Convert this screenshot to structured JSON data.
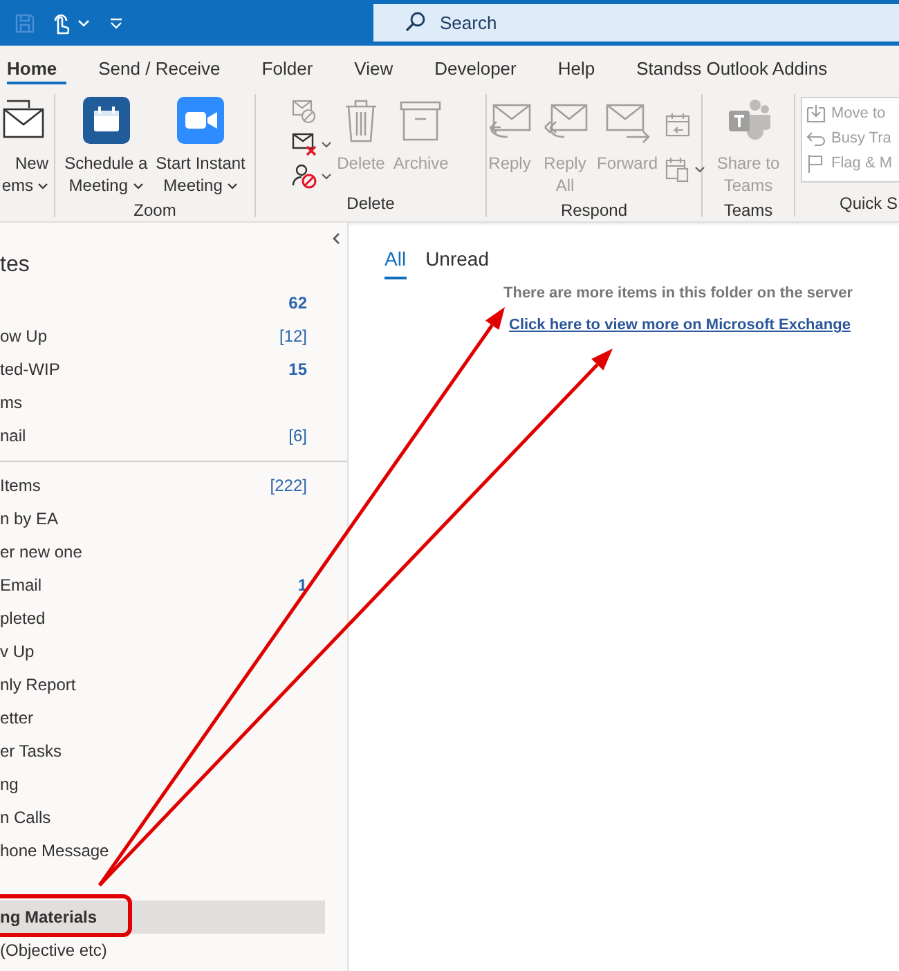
{
  "title_bar": {
    "search": {
      "placeholder": "Search"
    }
  },
  "ribbon_tabs": [
    {
      "label": "Home",
      "selected": true
    },
    {
      "label": "Send / Receive",
      "selected": false
    },
    {
      "label": "Folder",
      "selected": false
    },
    {
      "label": "View",
      "selected": false
    },
    {
      "label": "Developer",
      "selected": false
    },
    {
      "label": "Help",
      "selected": false
    },
    {
      "label": "Standss Outlook Addins",
      "selected": false
    }
  ],
  "ribbon_groups": [
    {
      "items": [
        {
          "kind": "large",
          "lines": [
            "New",
            "ems"
          ],
          "dropdown": true,
          "disabled": false
        }
      ]
    },
    {
      "label": "Zoom",
      "items": [
        {
          "kind": "large",
          "lines": [
            "Schedule a",
            "Meeting"
          ],
          "dropdown": true,
          "disabled": false
        },
        {
          "kind": "large",
          "lines": [
            "Start Instant",
            "Meeting"
          ],
          "dropdown": true,
          "disabled": false
        }
      ]
    },
    {
      "label": "Delete",
      "items": [
        {
          "kind": "stack",
          "icons": [
            {
              "dropdown": false
            },
            {
              "dropdown": true
            },
            {
              "dropdown": true
            }
          ]
        },
        {
          "kind": "large",
          "lines": [
            "Delete"
          ],
          "dropdown": false,
          "disabled": true
        },
        {
          "kind": "large",
          "lines": [
            "Archive"
          ],
          "dropdown": false,
          "disabled": true
        }
      ]
    },
    {
      "label": "Respond",
      "items": [
        {
          "kind": "large",
          "lines": [
            "Reply"
          ],
          "dropdown": false,
          "disabled": true
        },
        {
          "kind": "large",
          "lines": [
            "Reply",
            "All"
          ],
          "dropdown": false,
          "disabled": true
        },
        {
          "kind": "large",
          "lines": [
            "Forward"
          ],
          "dropdown": false,
          "disabled": true
        },
        {
          "kind": "stack",
          "icons": [
            {
              "dropdown": false
            },
            {
              "dropdown": true
            }
          ]
        }
      ]
    },
    {
      "label": "Teams",
      "items": [
        {
          "kind": "large",
          "lines": [
            "Share to",
            "Teams"
          ],
          "dropdown": false,
          "disabled": true
        }
      ]
    },
    {
      "label": "Quick S",
      "items": [
        {
          "kind": "quick-steps",
          "entries": [
            {
              "label": "Move to",
              "disabled": true
            },
            {
              "label": "Busy Tra",
              "disabled": true
            },
            {
              "label": "Flag & M",
              "disabled": true
            }
          ]
        }
      ]
    }
  ],
  "folder_pane": {
    "header": "tes",
    "sections": [
      {
        "divider": false,
        "items": [
          {
            "count": "62",
            "unread": true,
            "selected": false
          },
          {
            "name": "ow Up",
            "count": "[12]",
            "unread": false,
            "selected": false
          },
          {
            "name": "ted-WIP",
            "count": "15",
            "unread": true,
            "selected": false
          },
          {
            "name": "ms",
            "selected": false
          },
          {
            "name": "nail",
            "count": "[6]",
            "unread": false,
            "selected": false
          }
        ]
      },
      {
        "divider": true,
        "items": [
          {
            "name": "Items",
            "count": "[222]",
            "unread": false,
            "selected": false
          },
          {
            "name": "n by EA",
            "selected": false
          },
          {
            "name": "er new one",
            "selected": false
          },
          {
            "name": "Email",
            "count": "1",
            "unread": true,
            "selected": false
          },
          {
            "name": "pleted",
            "selected": false
          },
          {
            "name": "v Up",
            "selected": false
          },
          {
            "name": "nly Report",
            "selected": false
          },
          {
            "name": "etter",
            "selected": false
          },
          {
            "name": "er Tasks",
            "selected": false
          },
          {
            "name": "ng",
            "selected": false
          },
          {
            "name": "n Calls",
            "selected": false
          },
          {
            "name": "hone Message",
            "selected": false
          }
        ]
      },
      {
        "divider": false,
        "items": [
          {
            "name": "ng Materials",
            "selected": true
          },
          {
            "name": "(Objective etc)",
            "selected": false
          }
        ]
      }
    ]
  },
  "message_list": {
    "filters": [
      {
        "label": "All",
        "selected": true
      },
      {
        "label": "Unread",
        "selected": false
      }
    ],
    "notice": "There are more items in this folder on the server",
    "link": "Click here to view more on Microsoft Exchange"
  }
}
